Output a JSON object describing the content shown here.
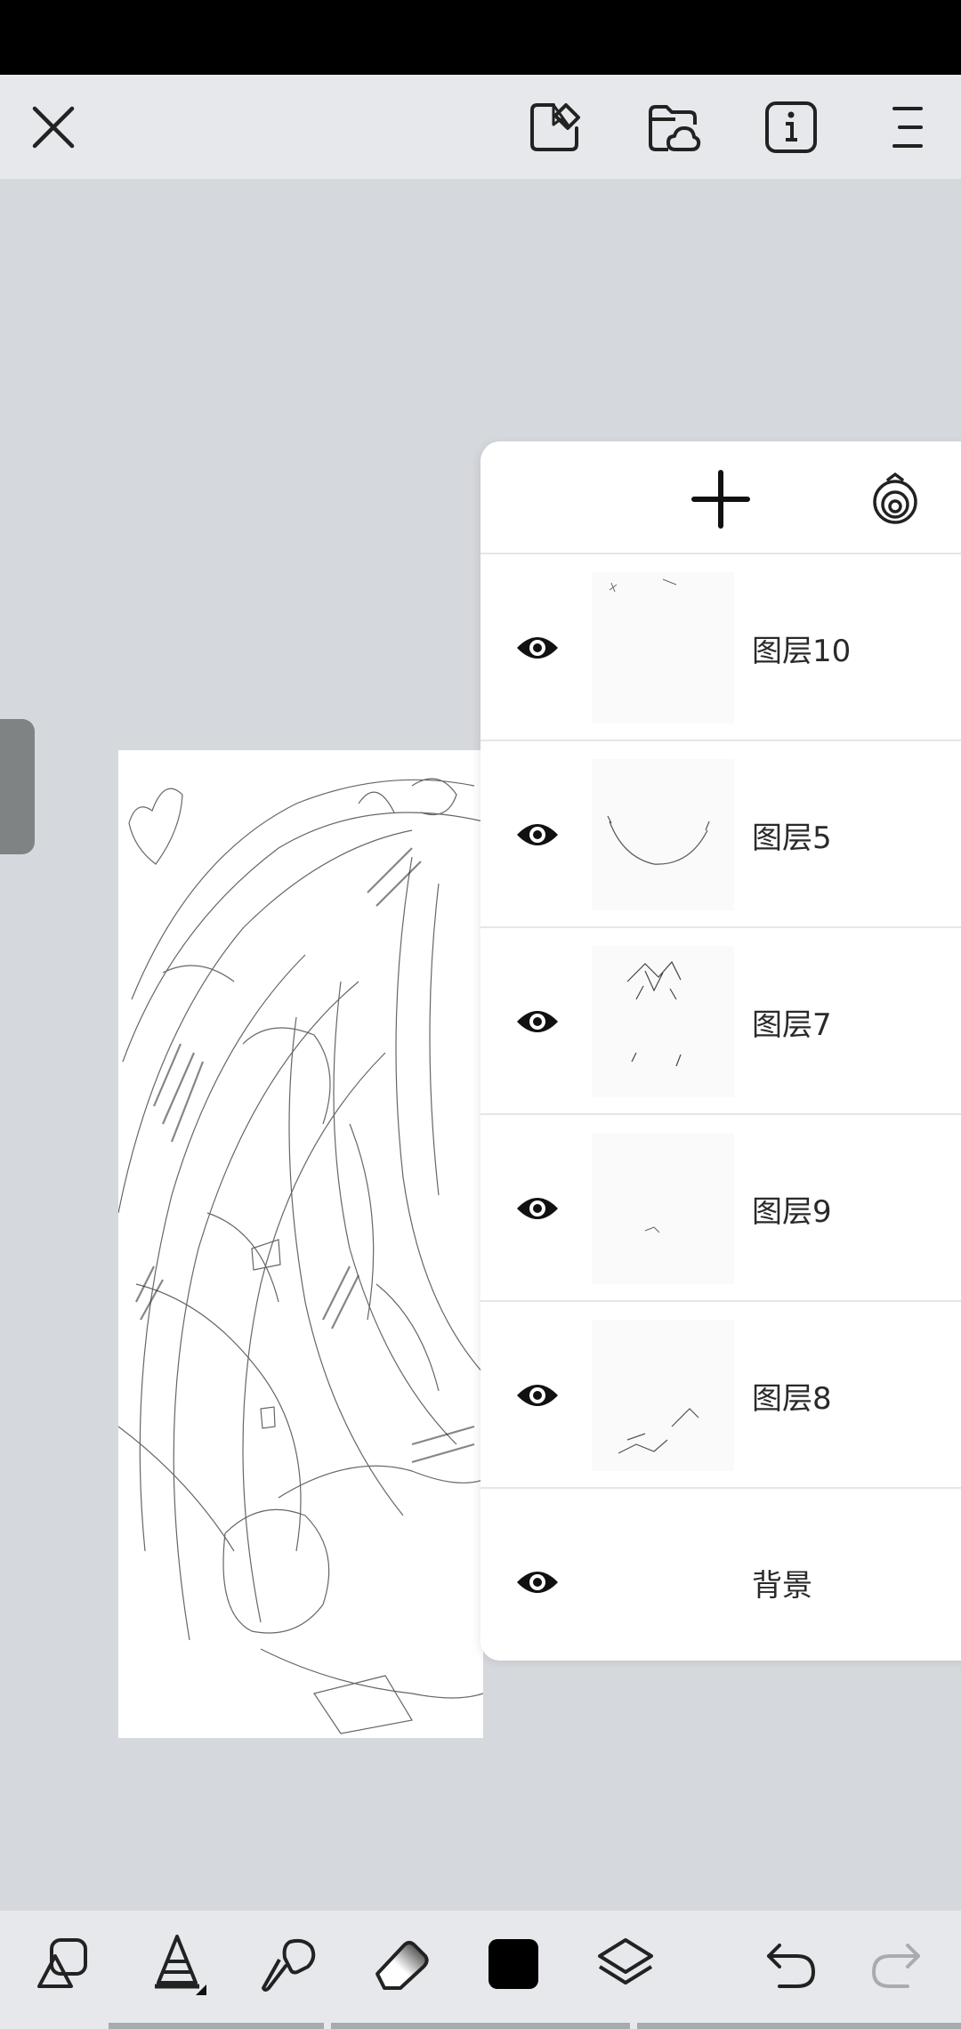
{
  "top_toolbar": {
    "close_icon": "close-icon",
    "export_icon": "export-icon",
    "cloud_folder_icon": "cloud-folder-icon",
    "info_icon": "info-icon",
    "menu_icon": "menu-icon"
  },
  "layers_panel": {
    "add_icon": "plus-icon",
    "settings_icon": "layer-blend-icon",
    "layers": [
      {
        "name": "图层10",
        "visible": true
      },
      {
        "name": "图层5",
        "visible": true
      },
      {
        "name": "图层7",
        "visible": true
      },
      {
        "name": "图层9",
        "visible": true
      },
      {
        "name": "图层8",
        "visible": true
      },
      {
        "name": "背景",
        "visible": true
      }
    ]
  },
  "bottom_toolbar": {
    "color": "#000000",
    "tools": [
      "shapes-icon",
      "pen-tool-icon",
      "brush-icon",
      "eraser-icon",
      "color-icon",
      "layers-icon",
      "undo-icon",
      "redo-icon"
    ]
  },
  "colors": {
    "background": "#d5d8dc",
    "toolbar": "#e6e8eb",
    "panel": "#ffffff"
  }
}
